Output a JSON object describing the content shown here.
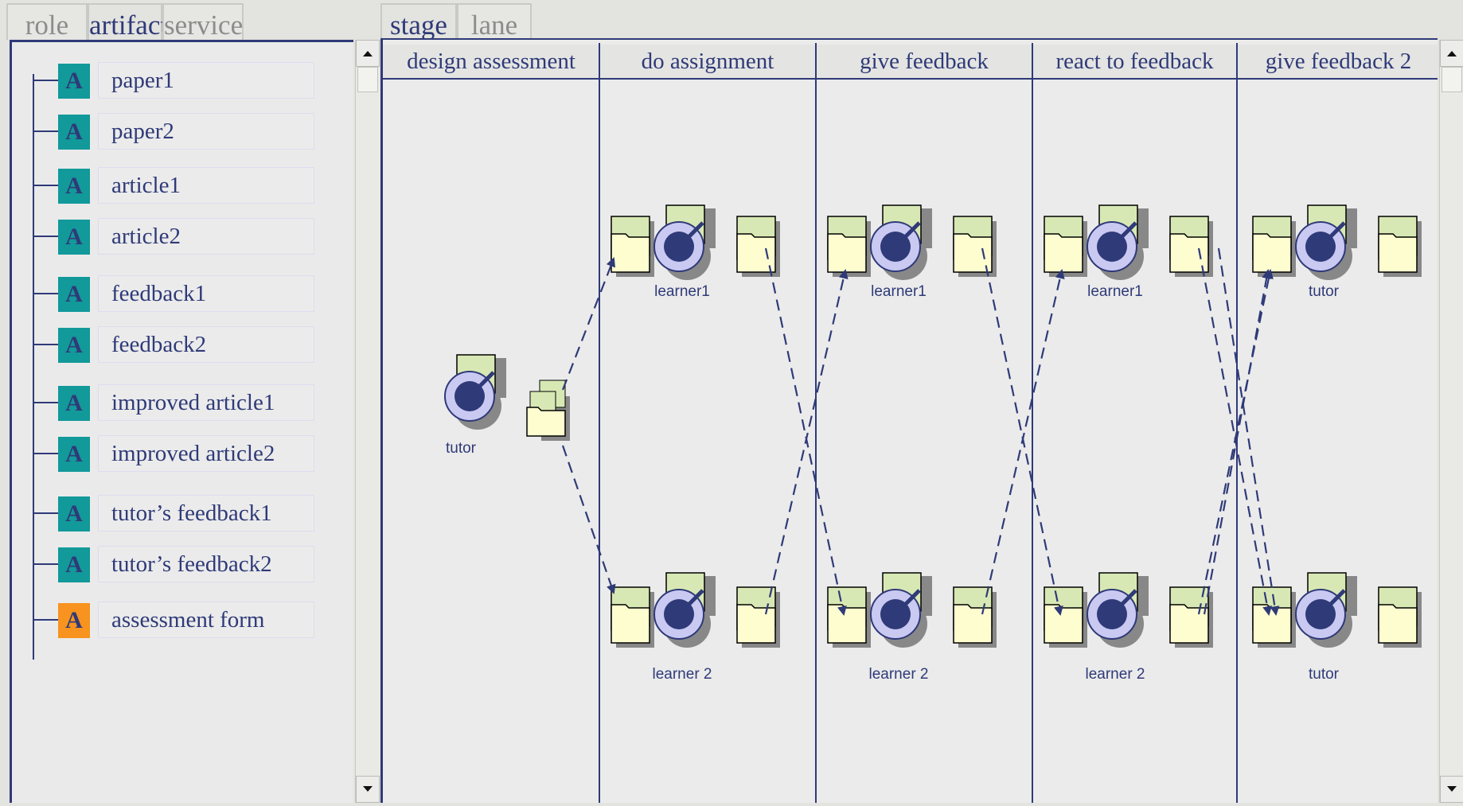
{
  "left_tabs": [
    "role",
    "artifact",
    "service"
  ],
  "right_tabs": [
    "stage",
    "lane"
  ],
  "artifacts": [
    {
      "label": "paper1",
      "icon_letter": "A",
      "icon_color": "#12999a"
    },
    {
      "label": "paper2",
      "icon_letter": "A",
      "icon_color": "#12999a"
    },
    {
      "label": "article1",
      "icon_letter": "A",
      "icon_color": "#12999a"
    },
    {
      "label": "article2",
      "icon_letter": "A",
      "icon_color": "#12999a"
    },
    {
      "label": "feedback1",
      "icon_letter": "A",
      "icon_color": "#12999a"
    },
    {
      "label": "feedback2",
      "icon_letter": "A",
      "icon_color": "#12999a"
    },
    {
      "label": "improved article1",
      "icon_letter": "A",
      "icon_color": "#12999a"
    },
    {
      "label": "improved article2",
      "icon_letter": "A",
      "icon_color": "#12999a"
    },
    {
      "label": "tutor’s feedback1",
      "icon_letter": "A",
      "icon_color": "#12999a"
    },
    {
      "label": "tutor’s feedback2",
      "icon_letter": "A",
      "icon_color": "#12999a"
    },
    {
      "label": "assessment form",
      "icon_letter": "A",
      "icon_color": "#f7931e"
    }
  ],
  "stages": [
    "design assessment",
    "do assignment",
    "give feedback",
    "react to feedback",
    "give feedback 2"
  ],
  "roles": {
    "design": "tutor",
    "top": [
      "learner1",
      "learner1",
      "learner1",
      "tutor"
    ],
    "bottom": [
      "learner 2",
      "learner 2",
      "learner 2",
      "tutor"
    ]
  },
  "colors": {
    "accent": "#2f3a78",
    "artifact_icon": "#12999a",
    "highlight_icon": "#f7931e",
    "doc_green": "#d8e8b4",
    "folder_yellow": "#fdfdd0",
    "role_ring": "#c9c9f2"
  }
}
